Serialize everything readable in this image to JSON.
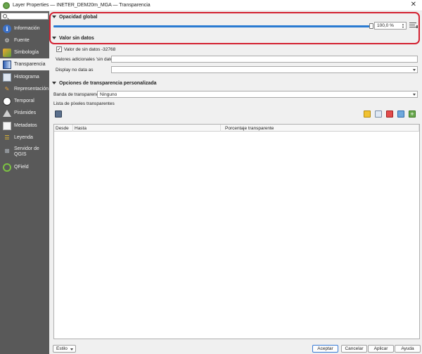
{
  "window": {
    "title": "Layer Properties — INETER_DEM20m_MGA — Transparencia",
    "close_glyph": "✕"
  },
  "sidebar": {
    "items": [
      {
        "label": "Información",
        "icon": "info-icon"
      },
      {
        "label": "Fuente",
        "icon": "source-icon"
      },
      {
        "label": "Simbología",
        "icon": "symbology-icon"
      },
      {
        "label": "Transparencia",
        "icon": "transparency-icon",
        "active": true
      },
      {
        "label": "Histograma",
        "icon": "histogram-icon"
      },
      {
        "label": "Representación",
        "icon": "rendering-icon"
      },
      {
        "label": "Temporal",
        "icon": "clock-icon"
      },
      {
        "label": "Pirámides",
        "icon": "pyramid-icon"
      },
      {
        "label": "Metadatos",
        "icon": "metadata-icon"
      },
      {
        "label": "Leyenda",
        "icon": "legend-icon"
      },
      {
        "label": "Servidor de QGIS",
        "icon": "server-icon"
      },
      {
        "label": "QField",
        "icon": "qfield-icon"
      }
    ]
  },
  "global_opacity": {
    "heading": "Opacidad global",
    "value_text": "100,0 %",
    "value": 100.0
  },
  "no_data": {
    "heading": "Valor sin datos",
    "checkbox_label": "Valor de sin datos",
    "checkbox_checked": true,
    "nodata_value": "-32768",
    "additional_label": "Valores adicionales 'sin dato'",
    "additional_value": "",
    "display_label": "Display no data as",
    "display_value": ""
  },
  "custom_transparency": {
    "heading": "Opciones de transparencia personalizada",
    "band_label": "Banda de transparencia",
    "band_value": "Ninguno",
    "list_label": "Lista de píxeles transparentes",
    "columns": [
      "Desde",
      "Hasta",
      "Porcentaje transparente"
    ],
    "rows": []
  },
  "footer": {
    "style_label": "Estilo",
    "ok_label": "Aceptar",
    "cancel_label": "Cancelar",
    "apply_label": "Aplicar",
    "help_label": "Ayuda"
  },
  "colors": {
    "accent": "#2a7ad1",
    "highlight": "#d32030",
    "sidebar_bg": "#595959"
  }
}
